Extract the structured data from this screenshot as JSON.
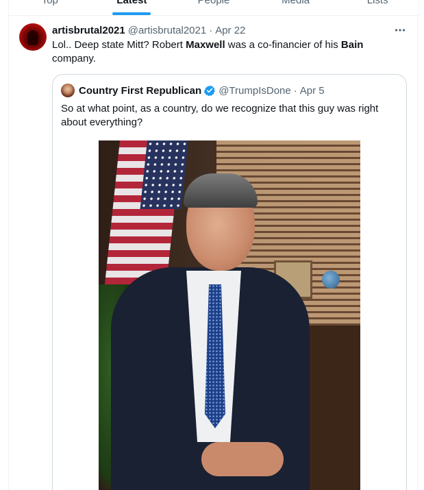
{
  "tabs": [
    {
      "label": "Top",
      "active": false
    },
    {
      "label": "Latest",
      "active": true
    },
    {
      "label": "People",
      "active": false
    },
    {
      "label": "Media",
      "active": false
    },
    {
      "label": "Lists",
      "active": false
    }
  ],
  "tweet": {
    "display_name": "artisbrutal2021",
    "handle": "@artisbrutal2021",
    "separator": "·",
    "date": "Apr 22",
    "more_icon": "more-dots-icon",
    "text_parts": [
      {
        "text": "Lol.. Deep state Mitt?  Robert ",
        "bold": false
      },
      {
        "text": "Maxwell",
        "bold": true
      },
      {
        "text": " was a co-financier of his ",
        "bold": false
      },
      {
        "text": "Bain",
        "bold": true
      },
      {
        "text": " company.",
        "bold": false
      }
    ]
  },
  "quote": {
    "display_name": "Country First Republican",
    "verified_icon": "verified-badge-icon",
    "verified_color": "#1d9bf0",
    "handle": "@TrumpIsDone",
    "separator": "·",
    "date": "Apr 5",
    "text": "So at what point, as a country, do we recognize that this guy was right about everything?",
    "photo_icon": "portrait-photo"
  },
  "colors": {
    "accent": "#1d9bf0",
    "text_primary": "#0f1419",
    "text_secondary": "#536471",
    "border": "#cfd9de"
  }
}
